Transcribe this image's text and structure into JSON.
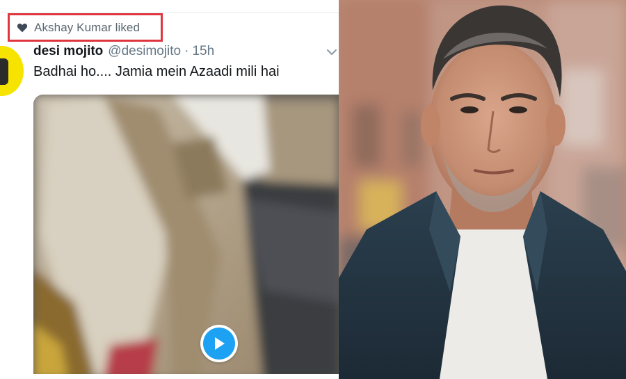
{
  "liked_banner": {
    "text": "Akshay Kumar liked"
  },
  "tweet": {
    "display_name": "desi mojito",
    "handle": "@desimojito",
    "separator": "·",
    "time": "15h",
    "text": "Badhai ho.... Jamia mein Azaadi mili hai"
  },
  "colors": {
    "highlight_border": "#e0353f",
    "play_accent": "#1da1f2",
    "avatar_bg": "#f7e300"
  },
  "icons": {
    "liked": "heart-icon",
    "menu": "chevron-down-icon",
    "play": "play-icon"
  }
}
